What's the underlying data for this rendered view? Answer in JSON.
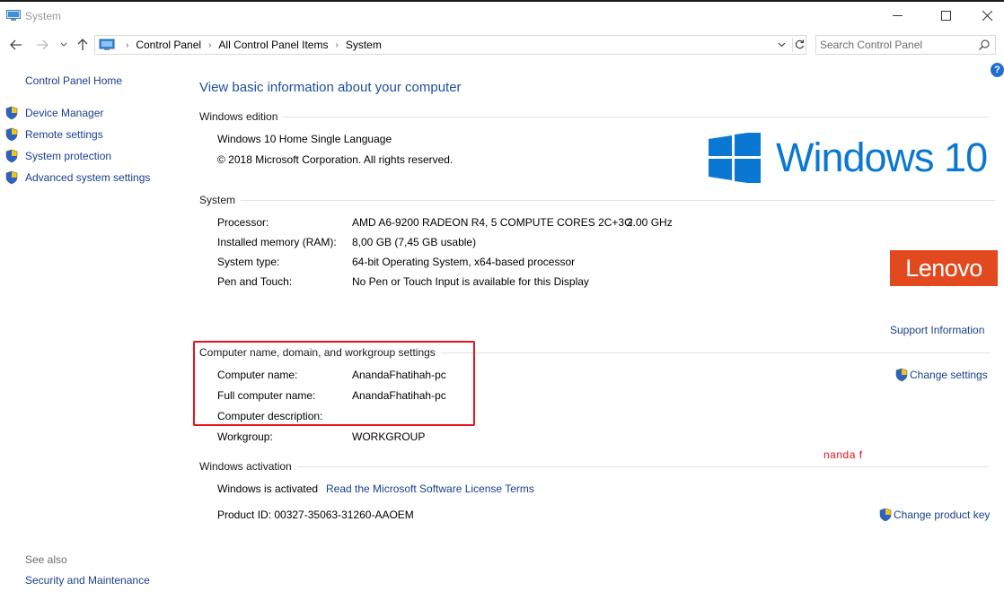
{
  "window": {
    "title": "System",
    "controls": {
      "minimize": "minimize-icon",
      "maximize": "maximize-icon",
      "close": "close-icon"
    }
  },
  "nav": {
    "breadcrumbs": [
      "Control Panel",
      "All Control Panel Items",
      "System"
    ],
    "search_placeholder": "Search Control Panel"
  },
  "sidebar": {
    "home": "Control Panel Home",
    "items": [
      {
        "label": "Device Manager",
        "icon": "shield-icon"
      },
      {
        "label": "Remote settings",
        "icon": "shield-icon"
      },
      {
        "label": "System protection",
        "icon": "shield-icon"
      },
      {
        "label": "Advanced system settings",
        "icon": "shield-icon"
      }
    ],
    "see_also_label": "See also",
    "see_also_items": [
      "Security and Maintenance"
    ]
  },
  "main": {
    "title": "View basic information about your computer",
    "windows_edition": {
      "heading": "Windows edition",
      "edition": "Windows 10 Home Single Language",
      "copyright": "© 2018 Microsoft Corporation. All rights reserved.",
      "logo_text": "Windows 10"
    },
    "system": {
      "heading": "System",
      "rows": [
        {
          "label": "Processor:",
          "value": "AMD A6-9200 RADEON R4, 5 COMPUTE CORES 2C+3G",
          "extra": "2.00 GHz"
        },
        {
          "label": "Installed memory (RAM):",
          "value": "8,00 GB (7,45 GB usable)"
        },
        {
          "label": "System type:",
          "value": "64-bit Operating System, x64-based processor"
        },
        {
          "label": "Pen and Touch:",
          "value": "No Pen or Touch Input is available for this Display"
        }
      ],
      "oem_logo": "Lenovo",
      "support_link": "Support Information"
    },
    "computer_name": {
      "heading": "Computer name, domain, and workgroup settings",
      "rows": [
        {
          "label": "Computer name:",
          "value": "AnandaFhatihah-pc"
        },
        {
          "label": "Full computer name:",
          "value": "AnandaFhatihah-pc"
        },
        {
          "label": "Computer description:",
          "value": ""
        },
        {
          "label": "Workgroup:",
          "value": "WORKGROUP"
        }
      ],
      "change_settings": "Change settings"
    },
    "activation": {
      "heading": "Windows activation",
      "status": "Windows is activated",
      "license_link": "Read the Microsoft Software License Terms",
      "product_id": "Product ID:  00327-35063-31260-AAOEM",
      "change_key": "Change product key"
    },
    "annotation": "nanda f"
  },
  "colors": {
    "link": "#1a3e8c",
    "title_blue": "#1e4f9c",
    "windows_blue": "#0a78d2",
    "lenovo_red": "#e2491e",
    "annotation_red": "#e8101e"
  }
}
